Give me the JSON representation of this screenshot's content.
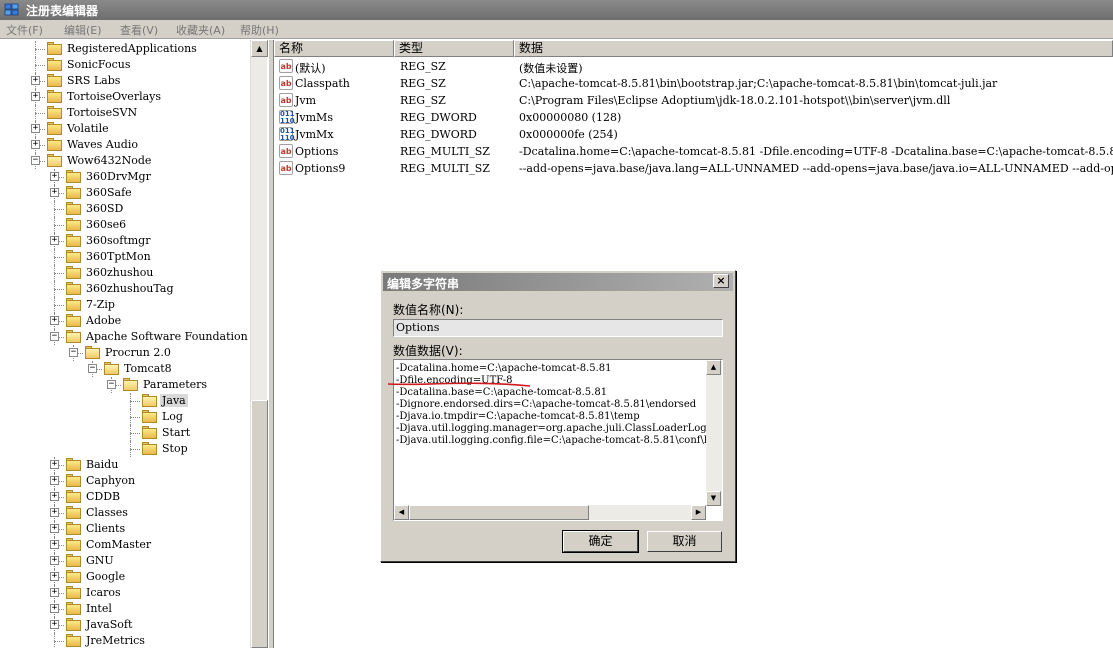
{
  "window": {
    "title": "注册表编辑器"
  },
  "menu": [
    "文件(F)",
    "编辑(E)",
    "查看(V)",
    "收藏夹(A)",
    "帮助(H)"
  ],
  "tree": [
    {
      "label": "RegisteredApplications",
      "expander": ""
    },
    {
      "label": "SonicFocus",
      "expander": ""
    },
    {
      "label": "SRS Labs",
      "expander": "+"
    },
    {
      "label": "TortoiseOverlays",
      "expander": "+"
    },
    {
      "label": "TortoiseSVN",
      "expander": ""
    },
    {
      "label": "Volatile",
      "expander": "+"
    },
    {
      "label": "Waves Audio",
      "expander": "+"
    },
    {
      "label": "Wow6432Node",
      "expander": "−"
    },
    {
      "label": "360DrvMgr",
      "expander": "+"
    },
    {
      "label": "360Safe",
      "expander": "+"
    },
    {
      "label": "360SD",
      "expander": ""
    },
    {
      "label": "360se6",
      "expander": ""
    },
    {
      "label": "360softmgr",
      "expander": "+"
    },
    {
      "label": "360TptMon",
      "expander": ""
    },
    {
      "label": "360zhushou",
      "expander": ""
    },
    {
      "label": "360zhushouTag",
      "expander": ""
    },
    {
      "label": "7-Zip",
      "expander": ""
    },
    {
      "label": "Adobe",
      "expander": "+"
    },
    {
      "label": "Apache Software Foundation",
      "expander": "−"
    },
    {
      "label": "Procrun 2.0",
      "expander": "−"
    },
    {
      "label": "Tomcat8",
      "expander": "−"
    },
    {
      "label": "Parameters",
      "expander": "−"
    },
    {
      "label": "Java",
      "expander": ""
    },
    {
      "label": "Log",
      "expander": ""
    },
    {
      "label": "Start",
      "expander": ""
    },
    {
      "label": "Stop",
      "expander": ""
    },
    {
      "label": "Baidu",
      "expander": "+"
    },
    {
      "label": "Caphyon",
      "expander": "+"
    },
    {
      "label": "CDDB",
      "expander": "+"
    },
    {
      "label": "Classes",
      "expander": "+"
    },
    {
      "label": "Clients",
      "expander": "+"
    },
    {
      "label": "ComMaster",
      "expander": "+"
    },
    {
      "label": "GNU",
      "expander": "+"
    },
    {
      "label": "Google",
      "expander": "+"
    },
    {
      "label": "Icaros",
      "expander": "+"
    },
    {
      "label": "Intel",
      "expander": "+"
    },
    {
      "label": "JavaSoft",
      "expander": "+"
    },
    {
      "label": "JreMetrics",
      "expander": ""
    }
  ],
  "columns": [
    "名称",
    "类型",
    "数据"
  ],
  "values": [
    {
      "icon": "ab",
      "name": "(默认)",
      "type": "REG_SZ",
      "data": "(数值未设置)"
    },
    {
      "icon": "ab",
      "name": "Classpath",
      "type": "REG_SZ",
      "data": "C:\\apache-tomcat-8.5.81\\bin\\bootstrap.jar;C:\\apache-tomcat-8.5.81\\bin\\tomcat-juli.jar"
    },
    {
      "icon": "ab",
      "name": "Jvm",
      "type": "REG_SZ",
      "data": "C:\\Program Files\\Eclipse Adoptium\\jdk-18.0.2.101-hotspot\\\\bin\\server\\jvm.dll"
    },
    {
      "icon": "010",
      "name": "JvmMs",
      "type": "REG_DWORD",
      "data": "0x00000080 (128)"
    },
    {
      "icon": "010",
      "name": "JvmMx",
      "type": "REG_DWORD",
      "data": "0x000000fe (254)"
    },
    {
      "icon": "ab",
      "name": "Options",
      "type": "REG_MULTI_SZ",
      "data": "-Dcatalina.home=C:\\apache-tomcat-8.5.81 -Dfile.encoding=UTF-8 -Dcatalina.base=C:\\apache-tomcat-8.5.81"
    },
    {
      "icon": "ab",
      "name": "Options9",
      "type": "REG_MULTI_SZ",
      "data": "--add-opens=java.base/java.lang=ALL-UNNAMED --add-opens=java.base/java.io=ALL-UNNAMED --add-opens=java.rmi/sun.rmi"
    }
  ],
  "dialog": {
    "title": "编辑多字符串",
    "name_label": "数值名称(N):",
    "name_value": "Options",
    "data_label": "数值数据(V):",
    "data_lines": [
      "-Dcatalina.home=C:\\apache-tomcat-8.5.81",
      "-Dfile.encoding=UTF-8",
      "-Dcatalina.base=C:\\apache-tomcat-8.5.81",
      "-Dignore.endorsed.dirs=C:\\apache-tomcat-8.5.81\\endorsed",
      "-Djava.io.tmpdir=C:\\apache-tomcat-8.5.81\\temp",
      "-Djava.util.logging.manager=org.apache.juli.ClassLoaderLogManager",
      "-Djava.util.logging.config.file=C:\\apache-tomcat-8.5.81\\conf\\logging.properties"
    ],
    "ok_label": "确定",
    "cancel_label": "取消",
    "close_glyph": "×"
  },
  "colors": {
    "annotation": "#d0181f",
    "title_bar": "#6e6e6e",
    "window_bg": "#d4d0c8"
  }
}
